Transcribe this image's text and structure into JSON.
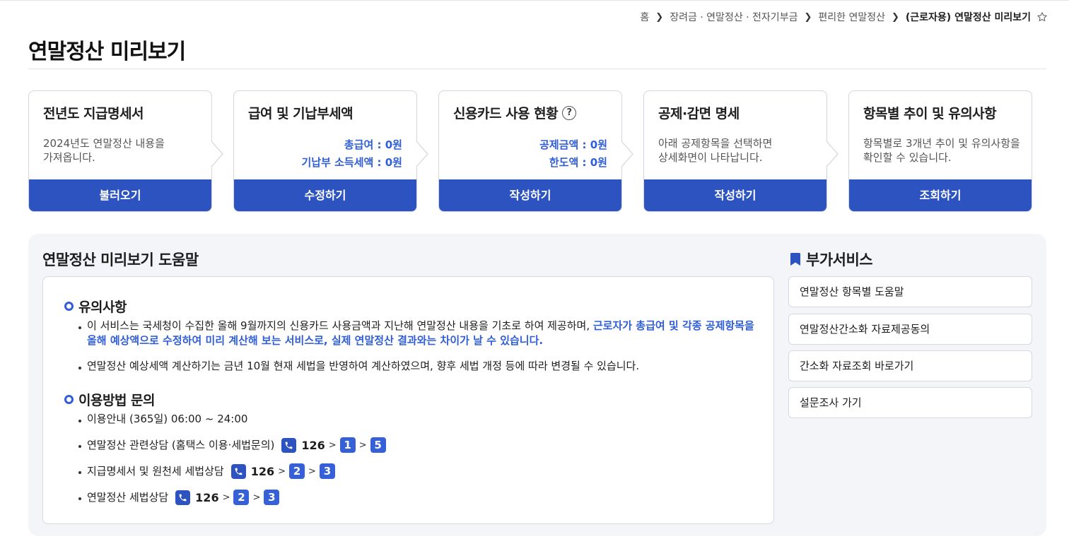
{
  "breadcrumb": {
    "items": [
      "홈",
      "장려금 · 연말정산 · 전자기부금",
      "편리한 연말정산",
      "(근로자용) 연말정산 미리보기"
    ],
    "star_icon": "star-outline-icon"
  },
  "page": {
    "title": "연말정산 미리보기"
  },
  "steps": [
    {
      "title": "전년도 지급명세서",
      "desc_line1": "2024년도 연말정산 내용을",
      "desc_line2": "가져옵니다.",
      "button": "불러오기"
    },
    {
      "title": "급여 및 기납부세액",
      "amount1": "총급여 : 0원",
      "amount2": "기납부 소득세액 : 0원",
      "button": "수정하기"
    },
    {
      "title": "신용카드 사용 현황",
      "help_glyph": "?",
      "amount1": "공제금액 : 0원",
      "amount2": "한도액 : 0원",
      "button": "작성하기"
    },
    {
      "title": "공제·감면 명세",
      "desc_line1": "아래 공제항목을 선택하면",
      "desc_line2": "상세화면이 나타납니다.",
      "button": "작성하기"
    },
    {
      "title": "항목별 추이 및 유의사항",
      "desc_line1": "항목별로 3개년 추이 및 유의사항을",
      "desc_line2": "확인할 수 있습니다.",
      "button": "조회하기"
    }
  ],
  "help": {
    "title": "연말정산 미리보기 도움말",
    "notice_heading": "유의사항",
    "notice1_plain": "이 서비스는 국세청이 수집한 올해 9월까지의 신용카드 사용금액과 지난해 연말정산 내용을 기초로 하여 제공하며, ",
    "notice1_emph_a": "근로자가 총급여 및 각종 공제항목을",
    "notice1_emph_b": "올해 예상액으로 수정하여 미리 계산해 보는 서비스로, 실제 연말정산 결과와는 차이가 날 수 있습니다.",
    "notice2": "연말정산 예상세액 계산하기는 금년 10월 현재 세법을 반영하여 계산하였으며, 향후 세법 개정 등에 따라 변경될 수 있습니다.",
    "usage_heading": "이용방법 문의",
    "hours": "이용안내 (365일) 06:00 ~ 24:00",
    "contact1_label": "연말정산 관련상담 (홈택스 이용·세법문의)",
    "contact1_number": "126",
    "contact1_keys": [
      "1",
      "5"
    ],
    "contact2_label": "지급명세서 및 원천세 세법상담",
    "contact2_number": "126",
    "contact2_keys": [
      "2",
      "3"
    ],
    "contact3_label": "연말정산 세법상담",
    "contact3_number": "126",
    "contact3_keys": [
      "2",
      "3"
    ]
  },
  "services": {
    "title": "부가서비스",
    "items": [
      "연말정산 항목별 도움말",
      "연말정산간소화 자료제공동의",
      "간소화 자료조회 바로가기",
      "설문조사 가기"
    ]
  },
  "colors": {
    "primary_button": "#2c53c0",
    "accent_text": "#2f5ed6",
    "panel_bg": "#f4f5f9"
  }
}
